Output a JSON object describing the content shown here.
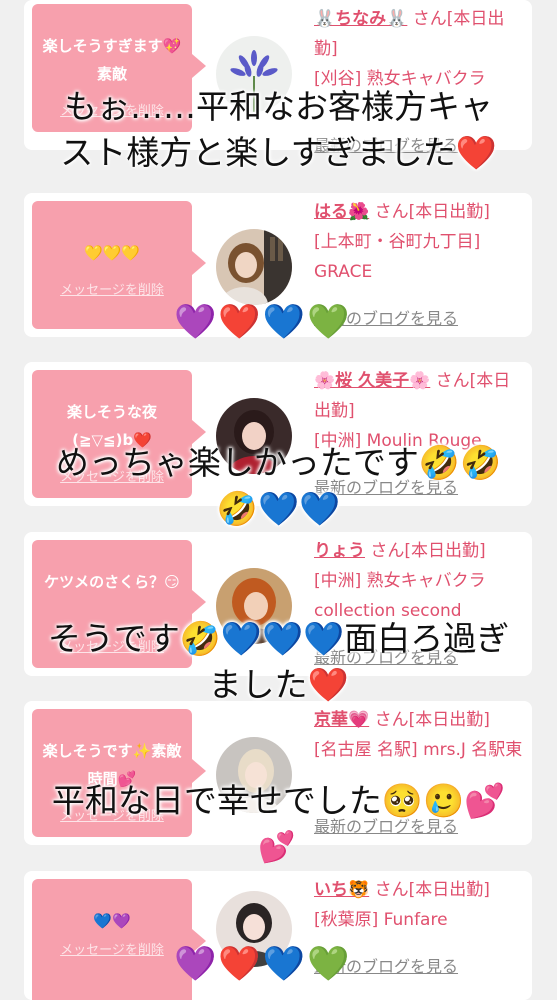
{
  "cards": [
    {
      "message": "楽しそうすぎます💖素敵",
      "delete_label": "メッセージを削除",
      "name": "🐰ちなみ🐰",
      "san": "さん",
      "status": "[本日出勤]",
      "shop": "[刈谷] 熟女キャバクラ",
      "blog_label": "最新のブログを見る",
      "avatar_icon": "agapanthus-flower-photo"
    },
    {
      "message": "💛💛💛",
      "delete_label": "メッセージを削除",
      "name": "はる🌺",
      "san": "さん",
      "status": "[本日出勤]",
      "shop": "[上本町・谷町九丁目] GRACE",
      "blog_label": "最新のブログを見る",
      "avatar_icon": "woman-photo"
    },
    {
      "message": "楽しそうな夜(≧▽≦)b❤️",
      "delete_label": "メッセージを削除",
      "name": "🌸桜 久美子🌸",
      "san": "さん",
      "status": "[本日出勤]",
      "shop": "[中洲] Moulin Rouge",
      "blog_label": "最新のブログを見る",
      "avatar_icon": "woman-photo"
    },
    {
      "message": "ケツメのさくら？😏",
      "delete_label": "メッセージを削除",
      "name": "りょう",
      "san": "さん",
      "status": "[本日出勤]",
      "shop": "[中洲] 熟女キャバクラ collection second",
      "blog_label": "最新のブログを見る",
      "avatar_icon": "woman-photo"
    },
    {
      "message": "楽しそうです✨素敵時間💕",
      "delete_label": "メッセージを削除",
      "name": "京華💗",
      "san": "さん",
      "status": "[本日出勤]",
      "shop": "[名古屋 名駅] mrs.J 名駅東",
      "blog_label": "最新のブログを見る",
      "avatar_icon": "woman-photo"
    },
    {
      "message": "💙💜",
      "delete_label": "メッセージを削除",
      "name": "いち🐯",
      "san": "さん",
      "status": "[本日出勤]",
      "shop": "[秋葉原] Funfare",
      "blog_label": "最新のブログを見る",
      "avatar_icon": "woman-photo"
    }
  ],
  "overlays": {
    "line1a": "もぉ……平和なお客様方キャ",
    "line1b": "スト様方と楽しすぎました",
    "line2": "めっちゃ楽しかったです",
    "line3a": "そうです",
    "line3b": "面白ろ過ぎ",
    "line3c": "ました",
    "line4": "平和な日で幸せでした"
  },
  "colors": {
    "bubble": "#f7a0ad",
    "name": "#e0506e",
    "background": "#f0f0f0"
  }
}
